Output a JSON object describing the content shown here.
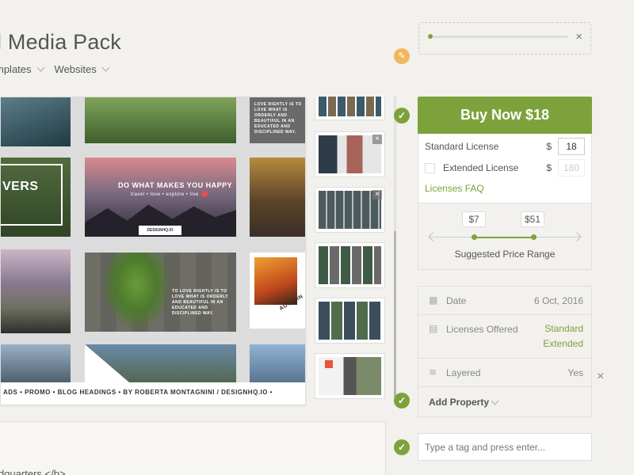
{
  "page": {
    "title": "l Media Pack",
    "nav": [
      {
        "label": "mplates"
      },
      {
        "label": "Websites"
      }
    ]
  },
  "preview": {
    "caption": "ADS • PROMO • BLOG HEADINGS • BY ROBERTA MONTAGNINI / DESIGNHQ.IO •",
    "tiles": {
      "t1": "LOVE RIGHTLY IS TO LOVE WHAT IS ORDERLY AND BEAUTIFUL IN AN EDUCATED AND DISCIPLINED WAY.",
      "t2": "VERS",
      "t3": "DO WHAT MAKES YOU HAPPY",
      "t3sub": "travel • love • explore • live",
      "t3brand": "DESIGNHQ.IO",
      "t4": "TO LOVE RIGHTLY IS TO LOVE WHAT IS ORDERLY AND BEAUTIFUL IN AN EDUCATED AND DISCIPLINED WAY.",
      "t5": "AUTUMN"
    }
  },
  "upload": {
    "progress": 0.02
  },
  "purchase": {
    "buy_label": "Buy Now $18",
    "standard_label": "Standard License",
    "standard_currency": "$",
    "standard_price": "18",
    "extended_label": "Extended License",
    "extended_currency": "$",
    "extended_price": "180",
    "faq_label": "Licenses FAQ"
  },
  "price_range": {
    "min": "$7",
    "max": "$51",
    "caption": "Suggested Price Range"
  },
  "properties": {
    "date_label": "Date",
    "date_value": "6 Oct, 2016",
    "licenses_label": "Licenses Offered",
    "licenses_value_1": "Standard",
    "licenses_value_2": "Extended",
    "layered_label": "Layered",
    "layered_value": "Yes",
    "add_label": "Add Property"
  },
  "tags": {
    "placeholder": "Type a tag and press enter..."
  },
  "editor": {
    "code": "dquarters </b>"
  },
  "colors": {
    "accent": "#7ea23b",
    "pencil": "#f0b75e",
    "background": "#f2f1ed"
  }
}
